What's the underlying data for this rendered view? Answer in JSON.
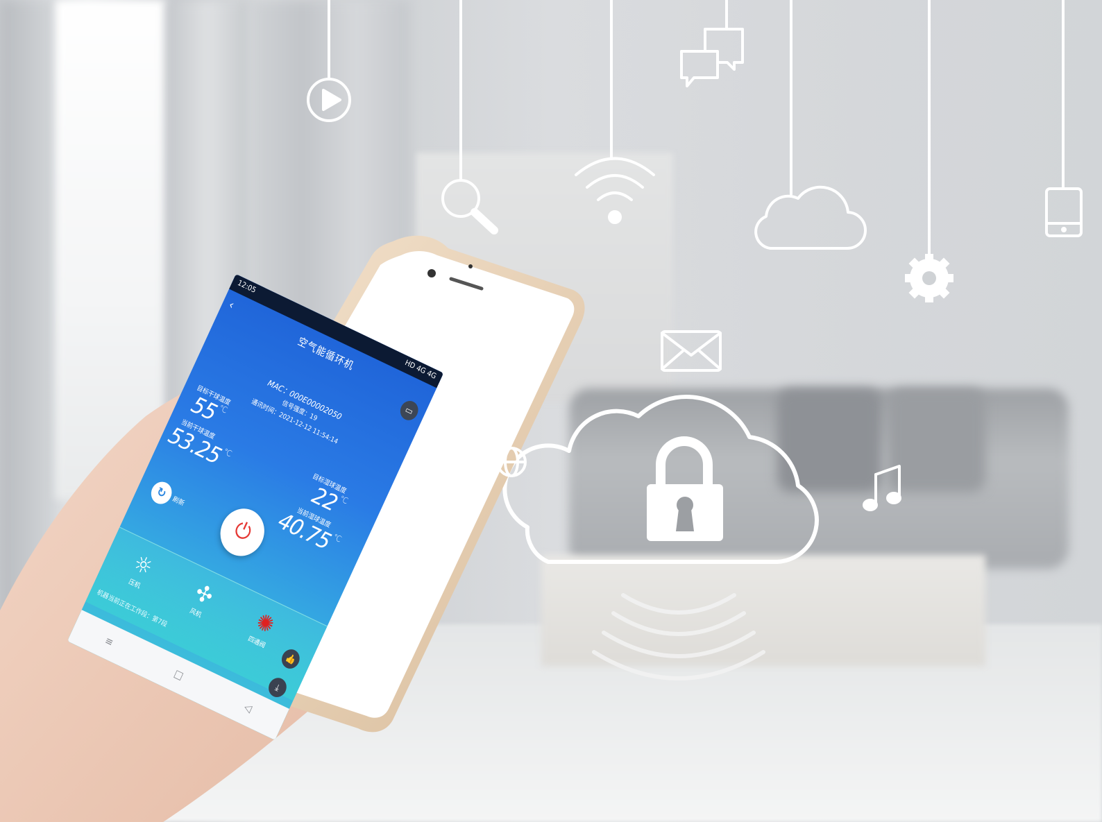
{
  "app": {
    "title": "空气能循环机",
    "status_time": "12:05",
    "status_right": "HD 4G 4G",
    "mac": "MAC：000E00002050",
    "signal": "信号强度：19",
    "comm_time": "通讯时间：2021-12-12 11:54:14",
    "target_dry_label": "目标干球温度",
    "target_dry_value": "55",
    "current_dry_label": "当前干球温度",
    "current_dry_value": "53.25",
    "target_wet_label": "目标湿球温度",
    "target_wet_value": "22",
    "current_wet_label": "当前湿球温度",
    "current_wet_value": "40.75",
    "unit": "℃",
    "refresh_label": "刷新",
    "tiles": [
      {
        "icon": "sun-icon",
        "label": "压机"
      },
      {
        "icon": "fan-icon",
        "label": "风机"
      },
      {
        "icon": "gear-icon",
        "label": "四通阀"
      }
    ],
    "work_status": "机器当前正在工作段：第7段"
  },
  "colors": {
    "screen_top": "#1f63d8",
    "screen_bottom": "#3fc4d8",
    "power_red": "#e53935",
    "icon_line": "#ffffff"
  },
  "icons": [
    "play-icon",
    "search-icon",
    "wifi-icon",
    "chat-icon",
    "cloud-icon",
    "gear-icon",
    "tablet-icon",
    "mail-icon",
    "cloud-lock-icon",
    "music-note-icon",
    "globe-icon",
    "signal-waves-icon"
  ]
}
